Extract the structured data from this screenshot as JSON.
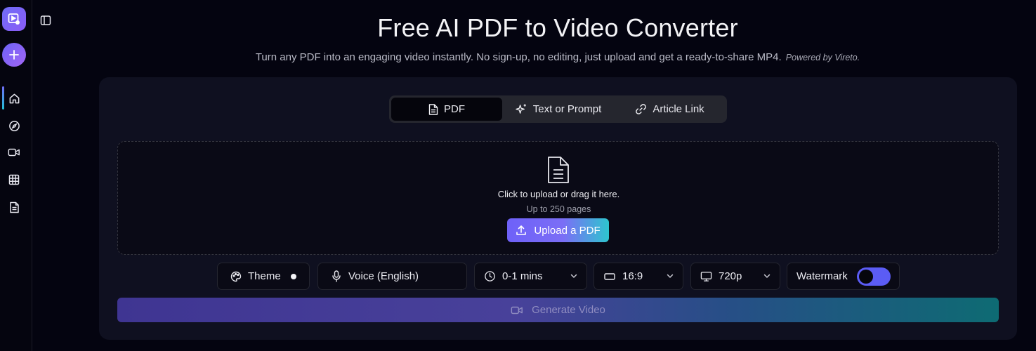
{
  "sidebar": {
    "logo_icon": "video-play-icon",
    "new_icon": "plus-icon",
    "nav": [
      {
        "icon": "home-icon",
        "active": true
      },
      {
        "icon": "compass-icon",
        "active": false
      },
      {
        "icon": "video-icon",
        "active": false
      },
      {
        "icon": "grid-icon",
        "active": false
      },
      {
        "icon": "document-icon",
        "active": false
      }
    ],
    "collapse_icon": "sidebar-toggle-icon"
  },
  "header": {
    "title": "Free AI PDF to Video Converter",
    "subtitle": "Turn any PDF into an engaging video instantly. No sign-up, no editing, just upload and get a ready-to-share MP4.",
    "powered_by": "Powered by Vireto."
  },
  "tabs": [
    {
      "label": "PDF",
      "icon": "file-icon",
      "active": true
    },
    {
      "label": "Text or Prompt",
      "icon": "sparkles-icon",
      "active": false
    },
    {
      "label": "Article Link",
      "icon": "link-icon",
      "active": false
    }
  ],
  "dropzone": {
    "main_text": "Click to upload or drag it here.",
    "sub_text": "Up to 250 pages",
    "button_label": "Upload a PDF",
    "button_icon": "upload-icon"
  },
  "options": {
    "theme": {
      "label": "Theme",
      "icon": "palette-icon"
    },
    "voice": {
      "label": "Voice (English)",
      "icon": "microphone-icon"
    },
    "duration": {
      "label": "0-1 mins",
      "icon": "clock-icon"
    },
    "aspect": {
      "label": "16:9",
      "icon": "rectangle-icon"
    },
    "resolution": {
      "label": "720p",
      "icon": "monitor-icon"
    },
    "watermark": {
      "label": "Watermark",
      "enabled": true
    }
  },
  "generate": {
    "label": "Generate Video",
    "icon": "video-icon"
  },
  "colors": {
    "accent": "#6e61f8",
    "accent_teal": "#2ec5cf",
    "background": "#040410",
    "panel": "#0f1020"
  }
}
